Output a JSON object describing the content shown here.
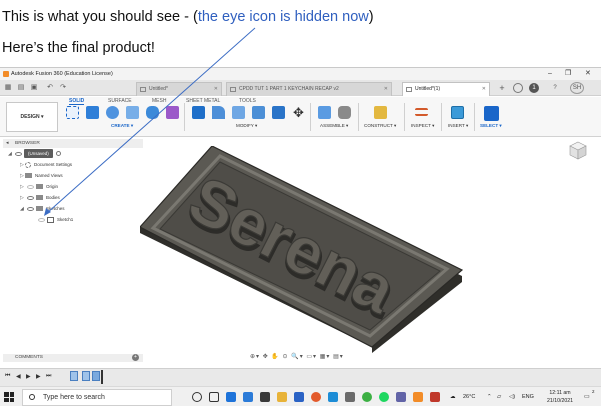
{
  "doc": {
    "line1_prefix": "This is what you should see - (",
    "line1_highlight": "the eye icon is hidden now",
    "line1_suffix": ")",
    "line2": "Here’s the final product!"
  },
  "window": {
    "title": "Autodesk Fusion 360 (Education License)",
    "controls": [
      "–",
      "❐",
      "✕"
    ]
  },
  "tabs": [
    {
      "label": "Untitled*",
      "active": false
    },
    {
      "label": "CPDD TUT 1 PART 1 KEYCHAIN RECAP v2",
      "active": false
    },
    {
      "label": "Untitled*(1)",
      "active": true
    }
  ],
  "header_right": {
    "counter": "1",
    "user": "SH"
  },
  "ribbon": {
    "workspace": "DESIGN ▾",
    "tabs": [
      "SOLID",
      "SURFACE",
      "MESH",
      "SHEET METAL",
      "TOOLS"
    ],
    "groups": [
      "CREATE ▾",
      "MODIFY ▾",
      "ASSEMBLE ▾",
      "CONSTRUCT ▾",
      "INSPECT ▾",
      "INSERT ▾",
      "SELECT ▾"
    ]
  },
  "browser": {
    "title": "BROWSER",
    "root": "(Unsaved)",
    "items": [
      "Document Settings",
      "Named Views",
      "Origin",
      "Bodies",
      "Sketches",
      "Sketch1"
    ]
  },
  "model": {
    "text": "Serena"
  },
  "comments": {
    "title": "COMMENTS"
  },
  "navbar": {
    "icons": "⊕▾ ✥ ✋ ⊙ 🔍▾ ▭▾ ▦▾ ▤▾"
  },
  "timeline": {
    "controls": [
      "⏮",
      "◀",
      "▶",
      "▶",
      "⏭"
    ]
  },
  "taskbar": {
    "search_placeholder": "Type here to search",
    "weather": "26°C",
    "lang": "ENG",
    "time": "12:11 am",
    "date": "21/10/2021",
    "notifications": "2"
  },
  "colors": {
    "accent": "#1a66c9",
    "annotation_blue": "#2f5fbf",
    "model_fill": "#55534d",
    "model_edge": "#2e2d29",
    "fusion_orange": "#f28c28"
  }
}
